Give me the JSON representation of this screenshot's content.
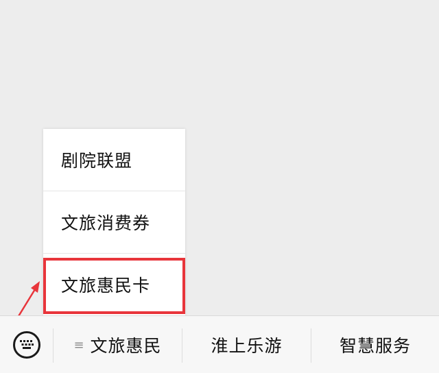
{
  "popup_menu": {
    "items": [
      {
        "label": "剧院联盟"
      },
      {
        "label": "文旅消费券"
      },
      {
        "label": "文旅惠民卡"
      }
    ],
    "highlighted_index": 2
  },
  "bottom_bar": {
    "keyboard_icon": "keyboard-icon",
    "menu_lines_glyph": "≡",
    "tabs": [
      {
        "label": "文旅惠民",
        "has_submenu": true
      },
      {
        "label": "淮上乐游"
      },
      {
        "label": "智慧服务"
      }
    ]
  },
  "annotation": {
    "arrow_color": "#e8353b",
    "box_color": "#e8353b"
  }
}
